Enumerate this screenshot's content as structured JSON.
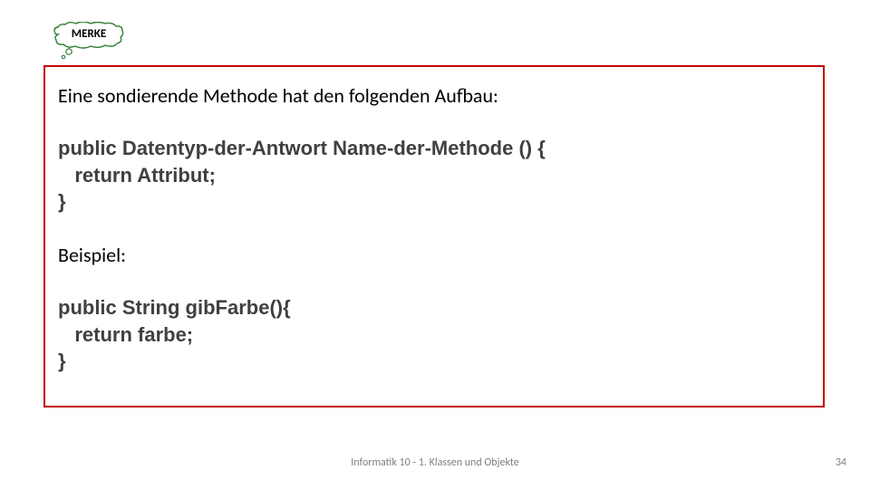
{
  "badge": {
    "label": "MERKE"
  },
  "content": {
    "intro": "Eine sondierende Methode hat  den folgenden Aufbau:",
    "template_code": "public Datentyp-der-Antwort Name-der-Methode () {\n   return Attribut;\n}",
    "example_label": "Beispiel:",
    "example_code": "public String gibFarbe(){\n   return farbe;\n}"
  },
  "footer": {
    "center": "Informatik 10 - 1. Klassen und Objekte",
    "page": "34"
  }
}
